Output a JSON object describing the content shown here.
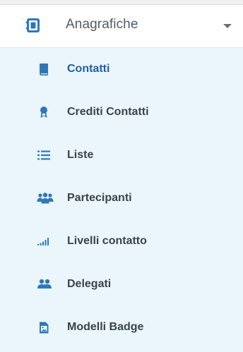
{
  "group": {
    "label": "Anagrafiche",
    "icon": "address-book-icon",
    "expanded": true
  },
  "colors": {
    "accent": "#1f5fa6",
    "icon": "#2f78b7",
    "submenu_bg": "#eaf6fb",
    "text": "#3c4349"
  },
  "items": [
    {
      "label": "Contatti",
      "icon": "book-icon",
      "active": true
    },
    {
      "label": "Crediti Contatti",
      "icon": "award-icon",
      "active": false
    },
    {
      "label": "Liste",
      "icon": "list-icon",
      "active": false
    },
    {
      "label": "Partecipanti",
      "icon": "users-icon",
      "active": false
    },
    {
      "label": "Livelli contatto",
      "icon": "signal-bars-icon",
      "active": false
    },
    {
      "label": "Delegati",
      "icon": "user-group-icon",
      "active": false
    },
    {
      "label": "Modelli Badge",
      "icon": "image-file-icon",
      "active": false
    }
  ]
}
